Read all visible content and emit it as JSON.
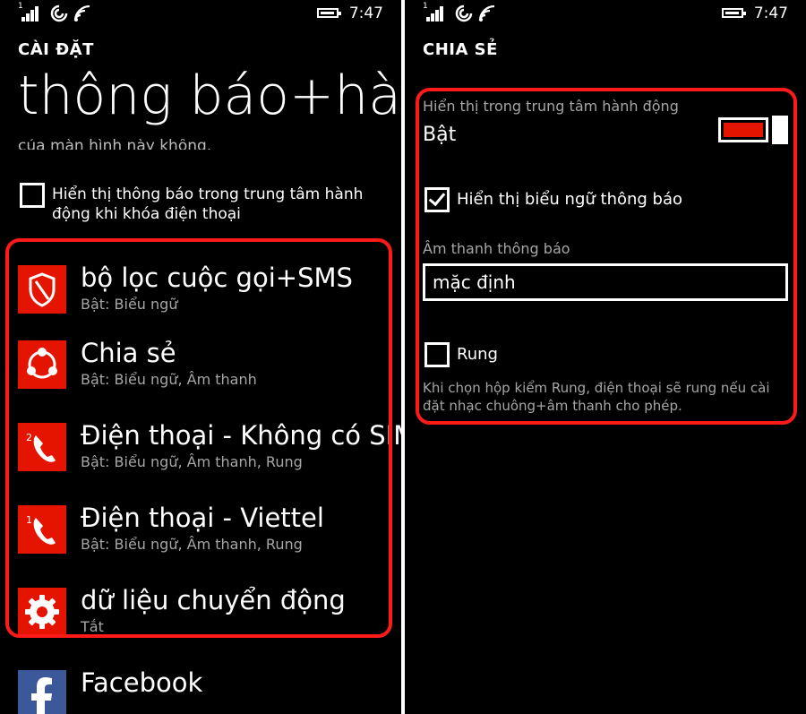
{
  "status_bar": {
    "signal_sim_number": "1",
    "time": "7:47"
  },
  "left": {
    "app_title": "CÀI ĐẶT",
    "page_title": "thông báo+hành",
    "cut_off_text": "của màn hình này không.",
    "lock_screen_option": {
      "label": "Hiển thị thông báo trong trung tâm hành động khi khóa điện thoại",
      "checked": false
    },
    "apps": [
      {
        "name": "bộ lọc cuộc gọi+SMS",
        "status": "Bật: Biểu ngữ",
        "icon": "shield-icon"
      },
      {
        "name": "Chia sẻ",
        "status": "Bật: Biểu ngữ, Âm thanh",
        "icon": "share-icon"
      },
      {
        "name": "Điện thoại - Không có SIM",
        "status": "Bật: Biểu ngữ, Âm thanh, Rung",
        "icon": "phone-sim2-icon",
        "sim_badge": "2"
      },
      {
        "name": "Điện thoại - Viettel",
        "status": "Bật: Biểu ngữ, Âm thanh, Rung",
        "icon": "phone-sim1-icon",
        "sim_badge": "1"
      },
      {
        "name": "dữ liệu chuyển động",
        "status": "Tắt",
        "icon": "gear-icon"
      },
      {
        "name": "Facebook",
        "status": "",
        "icon": "facebook-icon"
      }
    ]
  },
  "right": {
    "app_title": "CHIA SẺ",
    "action_center": {
      "label": "Hiển thị trong trung tâm hành động",
      "value": "Bật",
      "on": true
    },
    "banner_option": {
      "label": "Hiển thị biểu ngữ thông báo",
      "checked": true
    },
    "sound": {
      "label": "Âm thanh thông báo",
      "value": "mặc định"
    },
    "vibrate": {
      "label": "Rung",
      "checked": false
    },
    "vibrate_note": "Khi chọn hộp kiểm Rung, điện thoại sẽ rung nếu cài đặt nhạc chuông+âm thanh cho phép."
  },
  "colors": {
    "accent": "#e51400",
    "highlight": "#ff1a1a",
    "facebook": "#3b5998",
    "background": "#000000",
    "secondary_text": "#a6a6a6"
  }
}
